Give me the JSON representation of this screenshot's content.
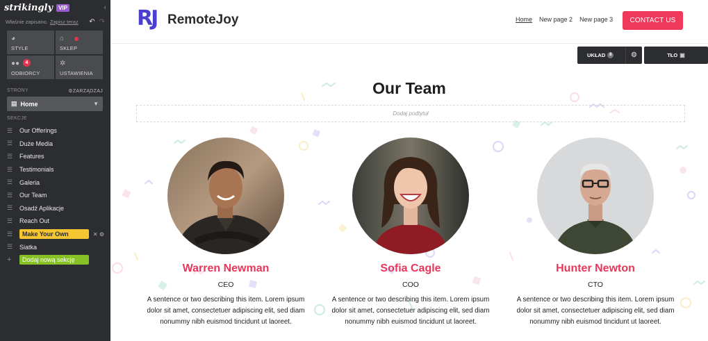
{
  "editor": {
    "logo": "strikingly",
    "vip_badge": "VIP",
    "saved_text": "Właśnie zapisano.",
    "save_now_link": "Zapisz teraz",
    "tiles": [
      {
        "label": "STYLE",
        "icon": "palette-icon"
      },
      {
        "label": "SKLEP",
        "icon": "store-icon"
      },
      {
        "label": "ODBIORCY",
        "icon": "people-icon",
        "badge": "4"
      },
      {
        "label": "USTAWIENIA",
        "icon": "gear-icon"
      }
    ],
    "pages_label": "STRONY",
    "manage_label": "ZARZĄDZAJ",
    "current_page": "Home",
    "sections_label": "SEKCJE",
    "sections": [
      "Our Offerings",
      "Duże Media",
      "Features",
      "Testimonials",
      "Galeria",
      "Our Team",
      "Osadź Aplikacje",
      "Reach Out",
      "Make Your Own",
      "Siatka"
    ],
    "add_section_label": "Dodaj nową sekcję",
    "accent_yellow": "#f5c532",
    "accent_green": "#86c126"
  },
  "site": {
    "brand_mark": "RJ",
    "brand_name": "RemoteJoy",
    "nav": [
      "Home",
      "New page 2",
      "New page 3"
    ],
    "cta_label": "CONTACT US",
    "brand_color": "#4b3fcf",
    "cta_color": "#f0395a"
  },
  "section_controls": {
    "layout_label": "UKŁAD",
    "layout_count": "8",
    "background_label": "TŁO"
  },
  "team": {
    "title": "Our Team",
    "subtitle_placeholder": "Dodaj podtytuł",
    "members": [
      {
        "name": "Warren Newman",
        "role": "CEO",
        "description": "A sentence or two describing this item. Lorem ipsum dolor sit amet, consectetuer adipiscing elit, sed diam nonummy nibh euismod tincidunt ut laoreet."
      },
      {
        "name": "Sofia Cagle",
        "role": "COO",
        "description": "A sentence or two describing this item. Lorem ipsum dolor sit amet, consectetuer adipiscing elit, sed diam nonummy nibh euismod tincidunt ut laoreet."
      },
      {
        "name": "Hunter Newton",
        "role": "CTO",
        "description": "A sentence or two describing this item. Lorem ipsum dolor sit amet, consectetuer adipiscing elit, sed diam nonummy nibh euismod tincidunt ut laoreet."
      }
    ],
    "name_color": "#e8375a"
  }
}
